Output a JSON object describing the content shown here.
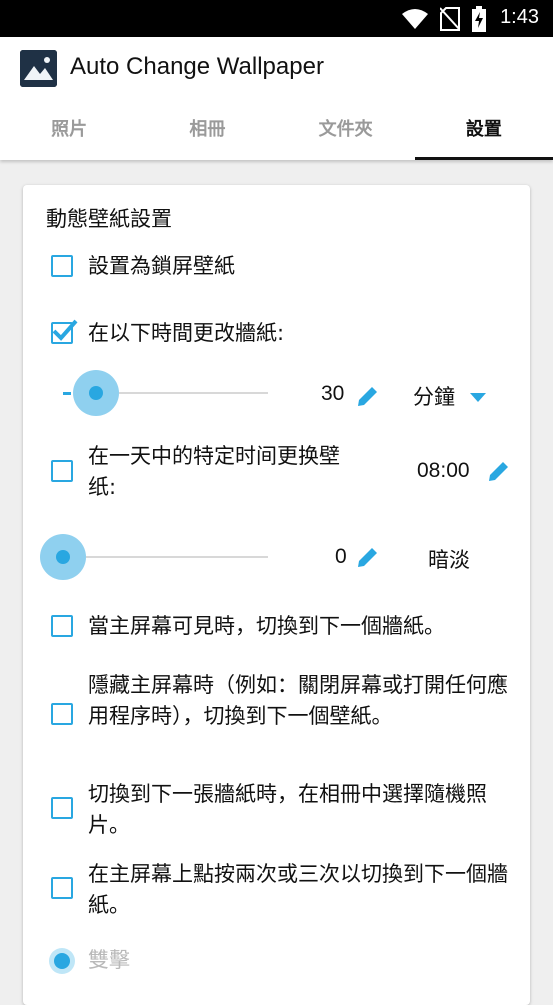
{
  "status_bar": {
    "time": "1:43",
    "icons": [
      "wifi-icon",
      "no-sim-icon",
      "battery-charging-icon"
    ]
  },
  "app": {
    "title": "Auto Change Wallpaper",
    "icon": "mountain-photo-icon"
  },
  "tabs": [
    {
      "label": "照片",
      "active": false
    },
    {
      "label": "相冊",
      "active": false
    },
    {
      "label": "文件夾",
      "active": false
    },
    {
      "label": "設置",
      "active": true
    }
  ],
  "settings": {
    "title": "動態壁紙設置",
    "lock_screen": {
      "label": "設置為鎖屏壁紙",
      "checked": false
    },
    "interval": {
      "label": "在以下時間更改牆紙:",
      "checked": true,
      "value": "30",
      "unit": "分鐘",
      "slider_fraction": 0.08
    },
    "specific_time": {
      "label": "在一天中的特定时间更换壁纸:",
      "checked": false,
      "time": "08:00"
    },
    "dim": {
      "value": "0",
      "label": "暗淡",
      "slider_fraction": 0.0
    },
    "home_visible": {
      "label": "當主屏幕可見時，切換到下一個牆紙。",
      "checked": false
    },
    "home_hidden": {
      "label": "隱藏主屏幕時（例如：關閉屏幕或打開任何應用程序時），切換到下一個壁紙。",
      "checked": false
    },
    "random_pick": {
      "label": "切換到下一張牆紙時，在相冊中選擇隨機照片。",
      "checked": false
    },
    "tap_switch": {
      "label": "在主屏幕上點按兩次或三次以切換到下一個牆紙。",
      "checked": false
    },
    "double_tap": {
      "label": "雙擊",
      "selected": true
    }
  },
  "colors": {
    "accent": "#29a7e1",
    "accent_light": "#8fd0ef"
  }
}
